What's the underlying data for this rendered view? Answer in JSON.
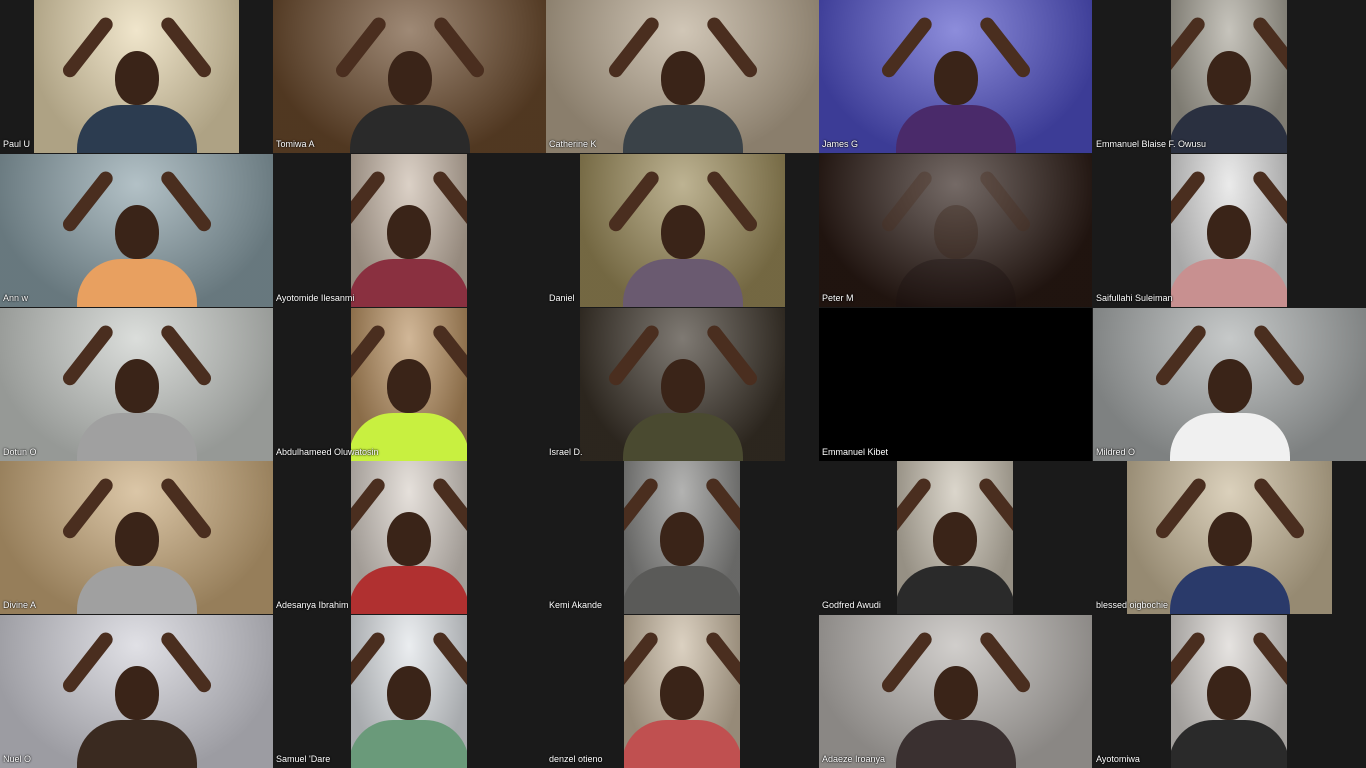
{
  "meeting": {
    "view": "gallery",
    "participants": [
      {
        "name": "Paul U",
        "bg": "#e8d8b0",
        "shirt": "#2c3c50",
        "video": "narrow-full"
      },
      {
        "name": "Tomiwa A",
        "bg": "#6b4a2c",
        "shirt": "#2a2a2a",
        "video": "full"
      },
      {
        "name": "Catherine K",
        "bg": "#b8a890",
        "shirt": "#3a4248",
        "video": "full"
      },
      {
        "name": "James G",
        "bg": "#5050c8",
        "shirt": "#4a2a6a",
        "video": "full"
      },
      {
        "name": "Emmanuel Blaise F. Owusu",
        "bg": "#a8a498",
        "shirt": "#2a3040",
        "video": "small"
      },
      {
        "name": "Ann w",
        "bg": "#8aa0a8",
        "shirt": "#e8a060",
        "video": "full"
      },
      {
        "name": "Ayotomide Ilesanmi",
        "bg": "#c8b8a8",
        "shirt": "#8a3040",
        "video": "small"
      },
      {
        "name": "Daniel",
        "bg": "#9a8a58",
        "shirt": "#6a5a70",
        "video": "wide"
      },
      {
        "name": "Peter M",
        "bg": "#2a1a14",
        "shirt": "#1a1010",
        "video": "full-dark"
      },
      {
        "name": "Saifullahi Suleiman",
        "bg": "#e0e0e0",
        "shirt": "#c89090",
        "video": "small"
      },
      {
        "name": "Dotun O",
        "bg": "#c8ccc8",
        "shirt": "#a0a0a0",
        "video": "full"
      },
      {
        "name": "Abdulhameed Oluwatosin",
        "bg": "#b89060",
        "shirt": "#c8f040",
        "video": "small"
      },
      {
        "name": "Israel D.",
        "bg": "#3a3228",
        "shirt": "#4a4a30",
        "video": "wide"
      },
      {
        "name": "Emmanuel Kibet",
        "bg": "#000000",
        "shirt": "#000000",
        "video": "off"
      },
      {
        "name": "Mildred O",
        "bg": "#a8acac",
        "shirt": "#f0f0f0",
        "video": "full"
      },
      {
        "name": "Divine A",
        "bg": "#c8a878",
        "shirt": "#a0a0a0",
        "video": "full"
      },
      {
        "name": "Adesanya Ibrahim",
        "bg": "#d8d0c8",
        "shirt": "#b03030",
        "video": "small"
      },
      {
        "name": "Kemi Akande",
        "bg": "#8a8a88",
        "shirt": "#5a5a58",
        "video": "small-center"
      },
      {
        "name": "Godfred Awudi",
        "bg": "#c8c0b0",
        "shirt": "#2a2a2a",
        "video": "small-center"
      },
      {
        "name": "blessed oigbochie",
        "bg": "#c8b898",
        "shirt": "#2a3a6a",
        "video": "wide-right"
      },
      {
        "name": "Nuel O",
        "bg": "#d0d0d8",
        "shirt": "#3a2a20",
        "video": "full"
      },
      {
        "name": "Samuel 'Dare",
        "bg": "#e0e4e8",
        "shirt": "#6a9a7a",
        "video": "small"
      },
      {
        "name": "denzel otieno",
        "bg": "#c8b8a0",
        "shirt": "#c05050",
        "video": "small-center"
      },
      {
        "name": "Adaeze Iroanya",
        "bg": "#b8b4b0",
        "shirt": "#3a3030",
        "video": "full"
      },
      {
        "name": "Ayotomiwa",
        "bg": "#d8d4d0",
        "shirt": "#2a2a2a",
        "video": "small"
      }
    ]
  }
}
